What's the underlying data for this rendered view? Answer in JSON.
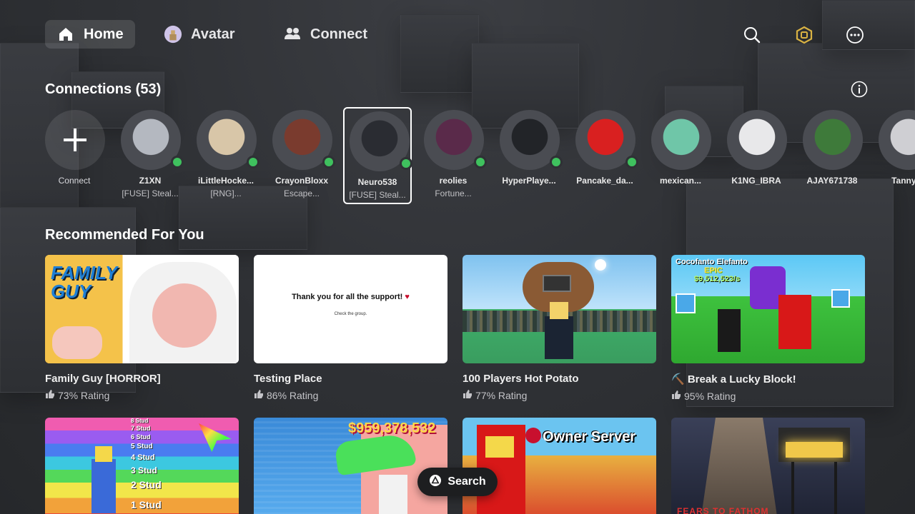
{
  "nav": {
    "home": "Home",
    "avatar": "Avatar",
    "connect": "Connect"
  },
  "connections": {
    "title": "Connections (53)",
    "add_label": "Connect",
    "items": [
      {
        "name": "Z1XN",
        "status": "[FUSE] Steal...",
        "online": true,
        "color": "#b4b8c0"
      },
      {
        "name": "iLittleHocke...",
        "status": "[RNG]...",
        "online": true,
        "color": "#d8c6a8"
      },
      {
        "name": "CrayonBloxx",
        "status": "Escape...",
        "online": true,
        "color": "#7a3b2e"
      },
      {
        "name": "Neuro538",
        "status": "[FUSE] Steal...",
        "online": true,
        "color": "#2a2c32",
        "selected": true
      },
      {
        "name": "reolies",
        "status": "Fortune...",
        "online": true,
        "color": "#5a2a4a"
      },
      {
        "name": "HyperPlaye...",
        "status": "",
        "online": true,
        "color": "#222428"
      },
      {
        "name": "Pancake_da...",
        "status": "",
        "online": true,
        "color": "#d92020"
      },
      {
        "name": "mexican...",
        "status": "",
        "online": false,
        "color": "#6fc6a8"
      },
      {
        "name": "K1NG_IBRA",
        "status": "",
        "online": false,
        "color": "#e8e8ea"
      },
      {
        "name": "AJAY671738",
        "status": "",
        "online": false,
        "color": "#3e7a3a"
      },
      {
        "name": "Tannyth",
        "status": "",
        "online": false,
        "color": "#cfcfd3"
      }
    ]
  },
  "recommended": {
    "title": "Recommended For You",
    "games": [
      {
        "title": "Family Guy [HORROR]",
        "rating": "73% Rating",
        "thumb_text": "FAMILY GUY"
      },
      {
        "title": "Testing Place",
        "rating": "86% Rating",
        "thumb_text": "Thank you for all the support!",
        "thumb_sub": "Check the group."
      },
      {
        "title": "100 Players Hot Potato",
        "rating": "77% Rating"
      },
      {
        "title": "⛏️ Break a Lucky Block!",
        "rating": "95% Rating",
        "thumb_text": "Cocofanto Elefanto",
        "thumb_sub": "EPIC",
        "thumb_sub2": "$9,512,523/s"
      }
    ],
    "row2": [
      {
        "thumb_text": "8 Stud",
        "lines": [
          "8 Stud",
          "7 Stud",
          "6 Stud",
          "5 Stud",
          "4 Stud",
          "3 Stud",
          "2 Stud",
          "1 Stud"
        ]
      },
      {
        "thumb_text": "$959,378,532"
      },
      {
        "thumb_text": "Owner Server"
      },
      {
        "thumb_text": "FEARS TO FATHOM"
      }
    ]
  },
  "search_button": "Search"
}
